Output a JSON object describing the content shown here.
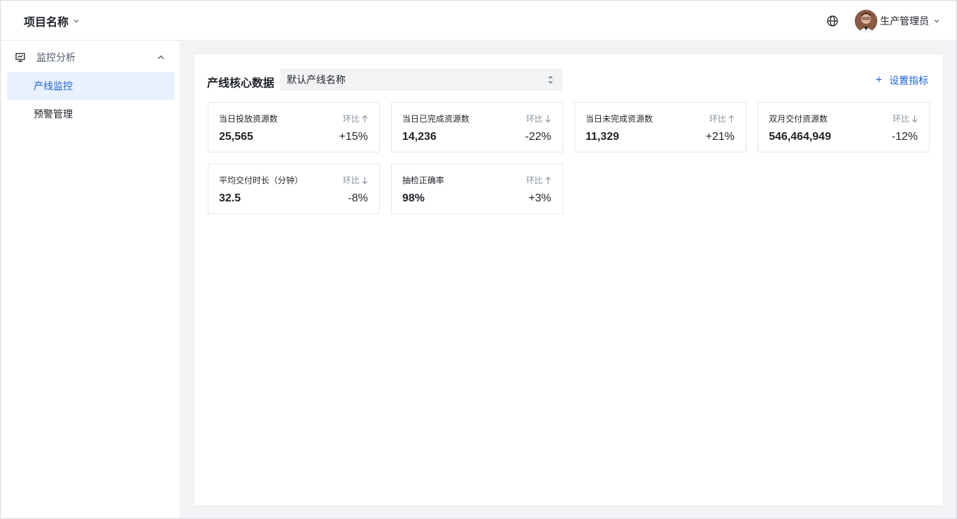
{
  "header": {
    "project_title": "项目名称",
    "user_name": "生产管理员",
    "icons": {
      "project_dropdown": "chevron-down-icon",
      "language": "globe-icon",
      "user_dropdown": "chevron-down-icon"
    }
  },
  "sidebar": {
    "group": {
      "label": "监控分析",
      "icon": "monitor-chart-icon",
      "expanded": true
    },
    "items": [
      {
        "label": "产线监控",
        "active": true
      },
      {
        "label": "预警管理",
        "active": false
      }
    ]
  },
  "main": {
    "section_title": "产线核心数据",
    "line_select": {
      "value": "默认产线名称"
    },
    "add_metric_label": "设置指标",
    "cards": [
      {
        "label": "当日投放资源数",
        "cmp_label": "环比",
        "trend": "up",
        "value": "25,565",
        "pct": "+15%"
      },
      {
        "label": "当日已完成资源数",
        "cmp_label": "环比",
        "trend": "down",
        "value": "14,236",
        "pct": "-22%"
      },
      {
        "label": "当日未完成资源数",
        "cmp_label": "环比",
        "trend": "up",
        "value": "11,329",
        "pct": "+21%"
      },
      {
        "label": "双月交付资源数",
        "cmp_label": "环比",
        "trend": "down",
        "value": "546,464,949",
        "pct": "-12%"
      },
      {
        "label": "平均交付时长（分钟）",
        "cmp_label": "环比",
        "trend": "down",
        "value": "32.5",
        "pct": "-8%"
      },
      {
        "label": "抽检正确率",
        "cmp_label": "环比",
        "trend": "up",
        "value": "98%",
        "pct": "+3%"
      }
    ]
  },
  "colors": {
    "accent": "#1f62d6",
    "active_bg": "#e8f1fd",
    "content_bg": "#f2f3f5"
  }
}
